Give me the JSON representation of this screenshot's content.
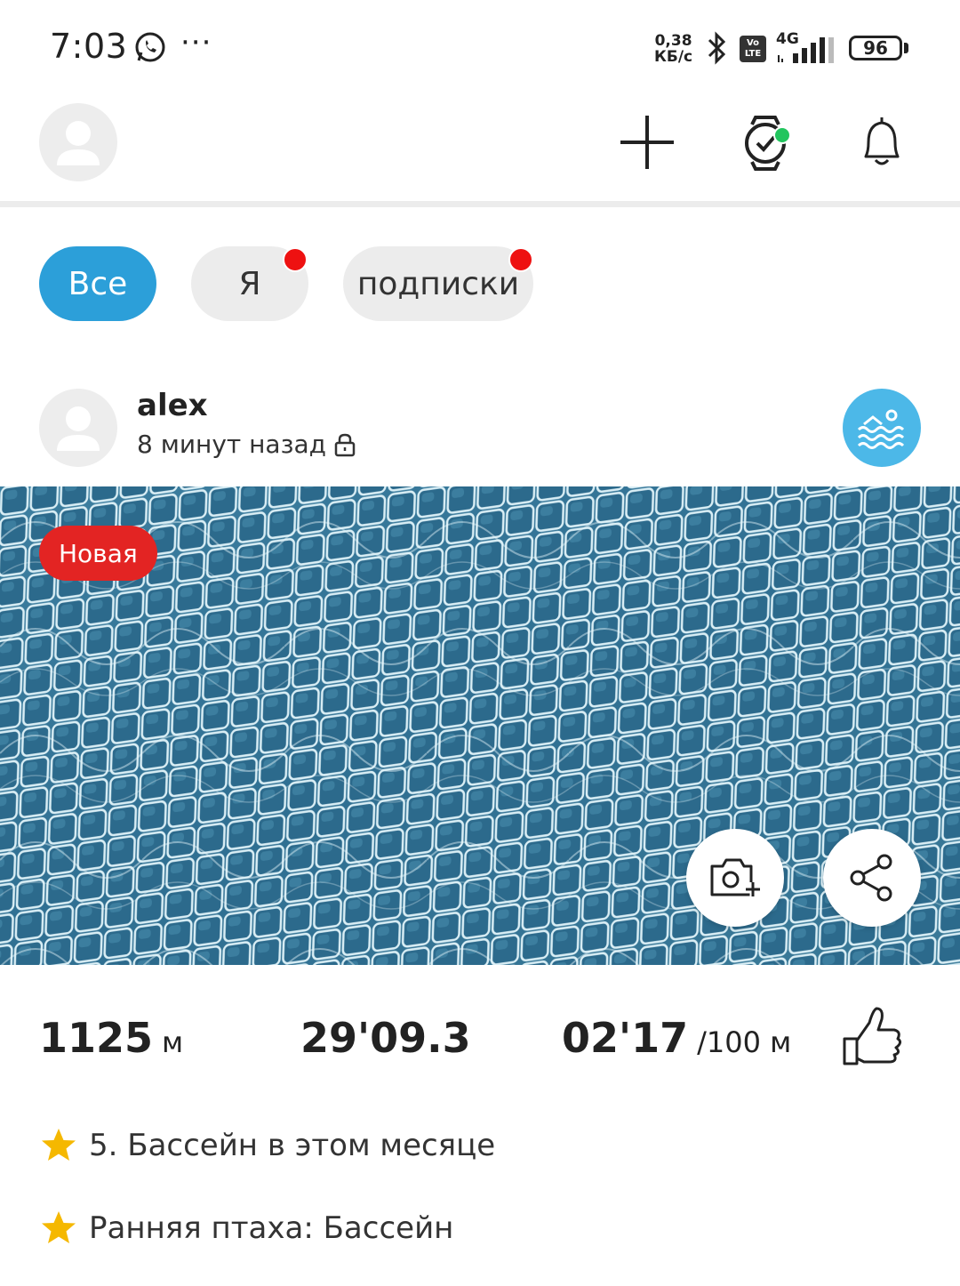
{
  "status_bar": {
    "time": "7:03",
    "dots": "···",
    "net_speed_value": "0,38",
    "net_speed_unit": "КБ/с",
    "volte_top": "Vo",
    "volte_bottom": "LTE",
    "network": "4G",
    "battery": "96"
  },
  "header": {
    "icons": [
      "avatar-icon",
      "plus-icon",
      "watch-icon",
      "bell-icon"
    ],
    "watch_status_color": "#22c55e"
  },
  "filters": {
    "all": "Все",
    "me": "Я",
    "subscriptions": "подписки",
    "active_color": "#2c9fd9",
    "dot_color": "#ee1111"
  },
  "post": {
    "username": "alex",
    "time_ago": "8 минут назад",
    "activity_icon": "swimming-icon",
    "badge": "Новая",
    "stats": {
      "distance_value": "1125",
      "distance_unit": "м",
      "duration": "29'09.3",
      "pace_value": "02'17",
      "pace_unit": "/100 м"
    },
    "achievements": [
      {
        "icon": "star-icon",
        "text": "5. Бассейн в этом месяце"
      },
      {
        "icon": "star-icon",
        "text": "Ранняя птаха: Бассейн"
      }
    ]
  },
  "colors": {
    "accent": "#2c9fd9",
    "swim": "#4cb8e8",
    "new_badge": "#e32423",
    "star": "#f5b800"
  }
}
